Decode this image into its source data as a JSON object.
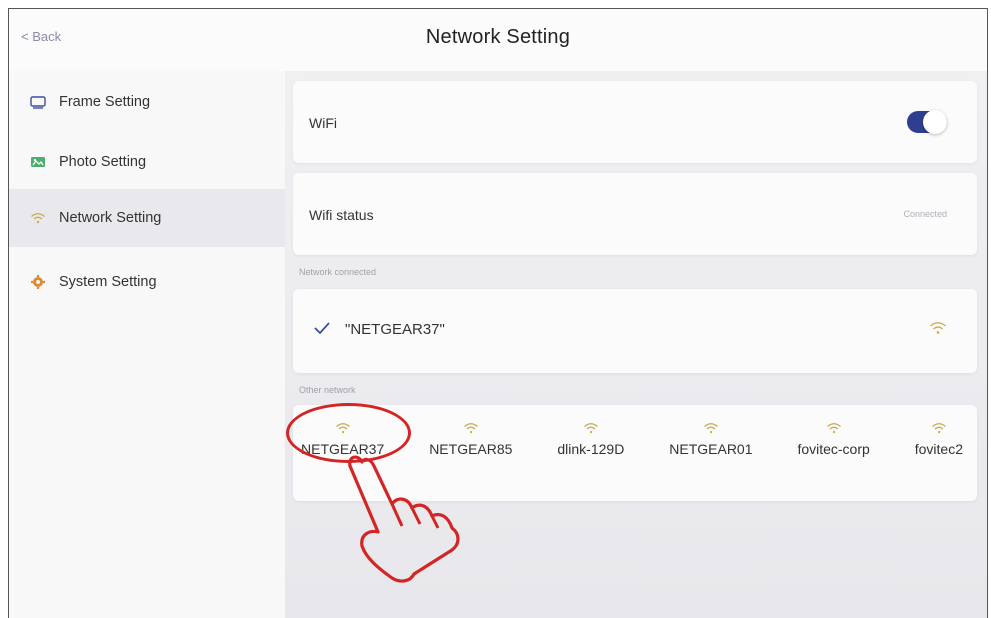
{
  "header": {
    "back_label": "< Back",
    "title": "Network Setting"
  },
  "sidebar": {
    "items": [
      {
        "label": "Frame Setting",
        "icon": "monitor-icon",
        "active": false
      },
      {
        "label": "Photo Setting",
        "icon": "photo-icon",
        "active": false
      },
      {
        "label": "Network Setting",
        "icon": "wifi-icon",
        "active": true
      },
      {
        "label": "System Setting",
        "icon": "gear-icon",
        "active": false
      }
    ]
  },
  "wifi": {
    "label": "WiFi",
    "enabled": true
  },
  "wifi_status": {
    "label": "Wifi status",
    "value": "Connected"
  },
  "connected_section": {
    "heading": "Network connected",
    "network_name": "\"NETGEAR37\""
  },
  "other_section": {
    "heading": "Other network",
    "networks": [
      "NETGEAR37",
      "NETGEAR85",
      "dlink-129D",
      "NETGEAR01",
      "fovitec-corp",
      "fovitec2"
    ]
  },
  "colors": {
    "accent": "#2f3f90",
    "highlight": "#d42424",
    "wifi_icon": "#c9a94a"
  }
}
